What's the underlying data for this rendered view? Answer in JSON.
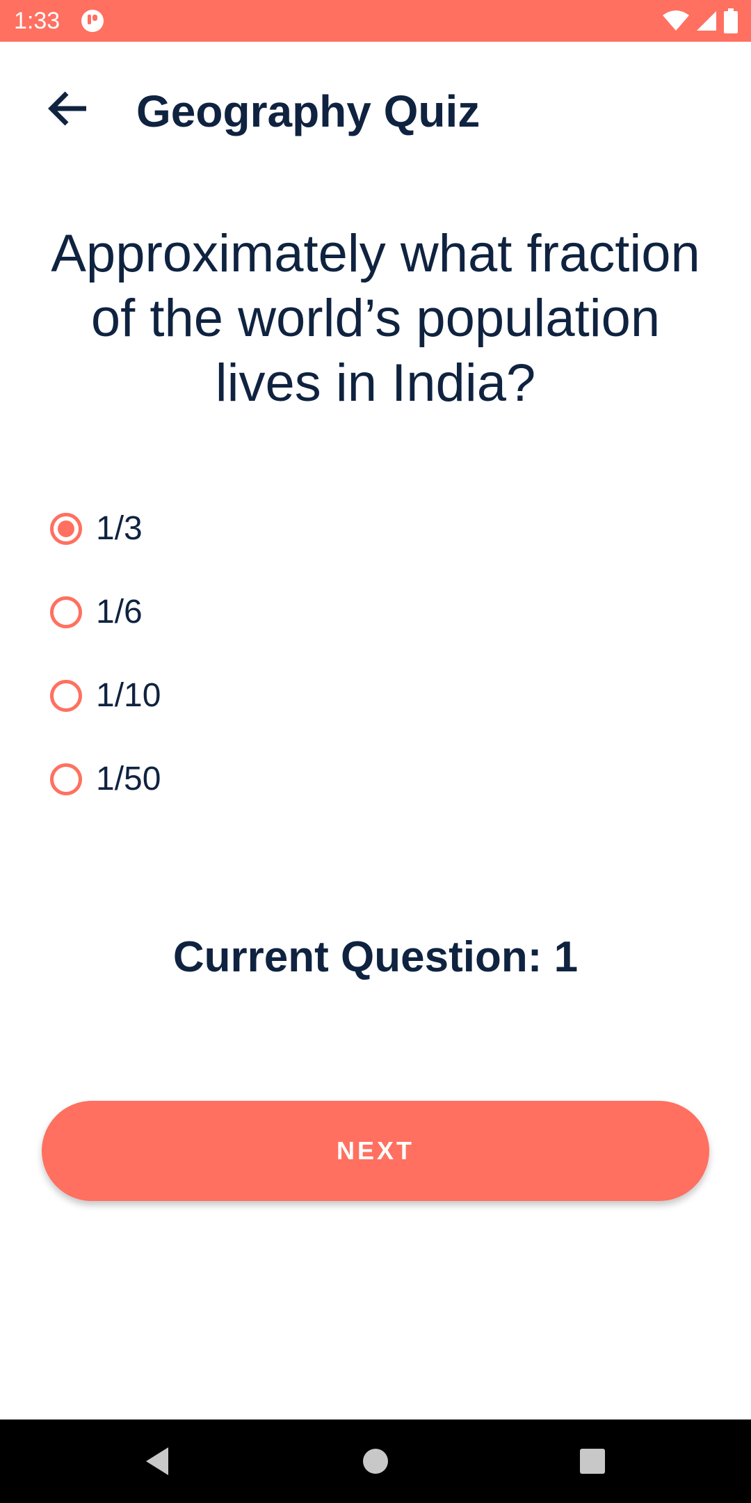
{
  "status_bar": {
    "time": "1:33",
    "background_color": "#ff7060",
    "icons": [
      "app-notification-icon",
      "wifi-icon",
      "cellular-signal-icon",
      "battery-icon"
    ]
  },
  "toolbar": {
    "back_icon": "arrow-back-icon",
    "title": "Geography Quiz"
  },
  "question": {
    "text": "Approximately what fraction of the world’s population lives in India?"
  },
  "options": [
    {
      "label": "1/3",
      "selected": true
    },
    {
      "label": "1/6",
      "selected": false
    },
    {
      "label": "1/10",
      "selected": false
    },
    {
      "label": "1/50",
      "selected": false
    }
  ],
  "current_question": {
    "text": "Current Question: 1"
  },
  "next_button": {
    "label": "NEXT"
  },
  "nav_bar": {
    "icons": [
      "back-triangle-icon",
      "home-circle-icon",
      "recents-square-icon"
    ]
  },
  "colors": {
    "accent": "#ff7060",
    "text": "#0f2340",
    "background": "#ffffff"
  }
}
